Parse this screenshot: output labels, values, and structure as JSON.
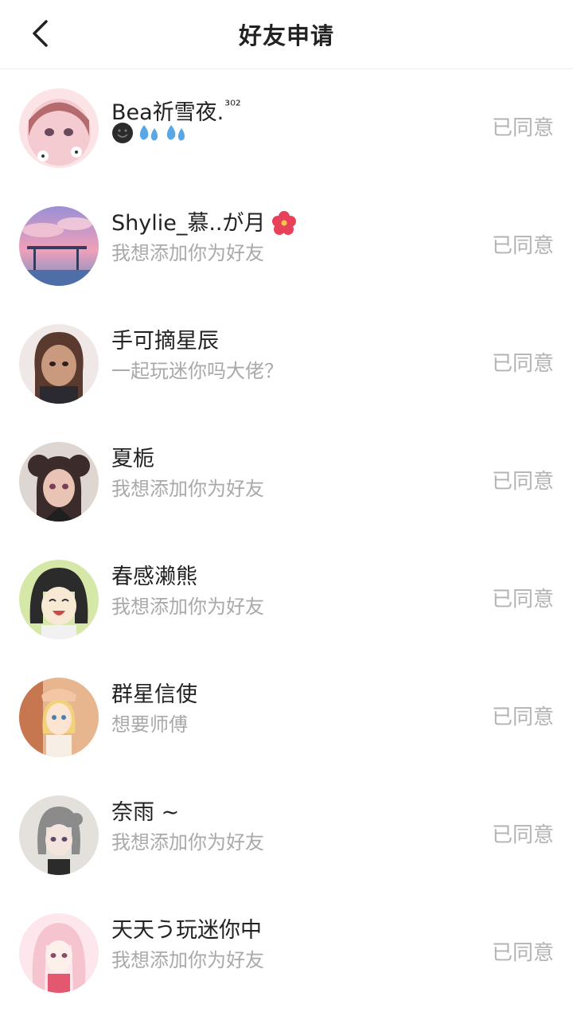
{
  "header": {
    "title": "好友申请"
  },
  "requests": [
    {
      "name": "Bea祈雪夜.",
      "name_sup": "³⁰²",
      "message": "",
      "status": "已同意",
      "avatar_colors": [
        "#f3cbd0",
        "#b56b6e",
        "#fbe3e6"
      ]
    },
    {
      "name": "Shylie_慕..が月",
      "message": "我想添加你为好友",
      "status": "已同意",
      "avatar_colors": [
        "#c9a7d8",
        "#f0a0b8",
        "#6d8fc9"
      ]
    },
    {
      "name": "手可摘星辰",
      "message": "一起玩迷你吗大佬？",
      "status": "已同意",
      "avatar_colors": [
        "#efe8e6",
        "#5a3a2e",
        "#c99a7e"
      ]
    },
    {
      "name": "夏栀",
      "message": "我想添加你为好友",
      "status": "已同意",
      "avatar_colors": [
        "#ded6d0",
        "#3b2b2b",
        "#e9c3b4"
      ]
    },
    {
      "name": "春感濑熊",
      "message": "我想添加你为好友",
      "status": "已同意",
      "avatar_colors": [
        "#d6e8a8",
        "#2b2b2b",
        "#f7e9d4"
      ]
    },
    {
      "name": "群星信使",
      "message": "想要师傅",
      "status": "已同意",
      "avatar_colors": [
        "#e7b68e",
        "#f1d27a",
        "#c7774f"
      ]
    },
    {
      "name": "奈雨 ~",
      "message": "我想添加你为好友",
      "status": "已同意",
      "avatar_colors": [
        "#e4e1dc",
        "#8b8b8b",
        "#f3e4dd"
      ]
    },
    {
      "name": "天天う玩迷你中",
      "message": "我想添加你为好友",
      "status": "已同意",
      "avatar_colors": [
        "#f6c4cf",
        "#e4586f",
        "#fde7ec"
      ]
    }
  ]
}
